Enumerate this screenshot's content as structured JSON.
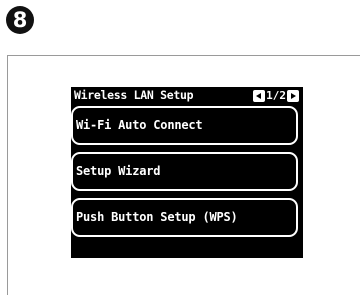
{
  "step": {
    "number": "8"
  },
  "screen": {
    "title": "Wireless LAN Setup",
    "page_indicator": "1/2",
    "menu_items": [
      {
        "label": "Wi-Fi Auto Connect"
      },
      {
        "label": "Setup Wizard"
      },
      {
        "label": "Push Button Setup (WPS)"
      }
    ]
  },
  "icons": {
    "prev": "left-arrow-icon",
    "next": "right-arrow-icon"
  },
  "colors": {
    "screen_background": "#000000",
    "screen_text": "#ffffff",
    "badge_background": "#111111"
  }
}
